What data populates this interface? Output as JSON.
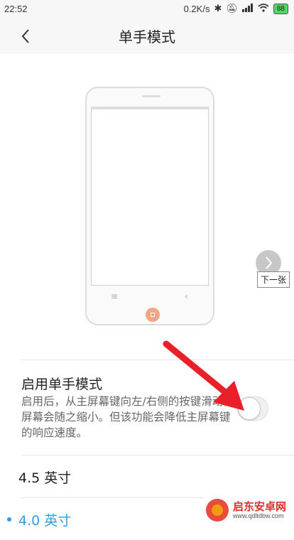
{
  "status_bar": {
    "time": "22:52",
    "network_speed": "0.2K/s",
    "battery": "88",
    "icons": [
      "bluetooth-icon",
      "mute-icon",
      "signal-icon",
      "wifi-icon",
      "battery-icon"
    ]
  },
  "header": {
    "title": "单手模式",
    "back_icon": "chevron-left-icon"
  },
  "preview": {
    "next_tooltip": "下一张"
  },
  "setting": {
    "title": "启用单手模式",
    "description": "启用后，从主屏幕键向左/右侧的按键滑动，屏幕会随之缩小。但该功能会降低主屏幕键的响应速度。",
    "enabled": false
  },
  "options": [
    {
      "label": "4.5 英寸",
      "selected": false
    },
    {
      "label": "4.0 英寸",
      "selected": true
    }
  ],
  "watermark": {
    "name": "启东安卓网",
    "url": "www.qdltdbw.com"
  },
  "colors": {
    "accent": "#2f9de4",
    "home_button": "#f5a582",
    "arrow": "#e8202a"
  }
}
